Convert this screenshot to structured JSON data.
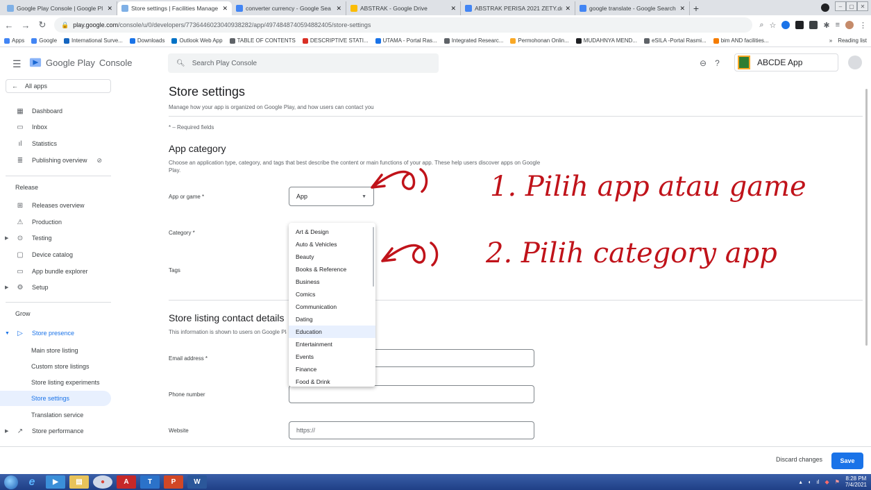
{
  "browser": {
    "tabs": [
      {
        "label": "Google Play Console | Google Pl",
        "active": false,
        "color": "#7fb0e6"
      },
      {
        "label": "Store settings | Facilities Manage",
        "active": true,
        "color": "#7fb0e6"
      },
      {
        "label": "converter currency - Google Sea",
        "active": false,
        "color": "#4285f4"
      },
      {
        "label": "ABSTRAK - Google Drive",
        "active": false,
        "color": "#fbbc04"
      },
      {
        "label": "ABSTRAK PERISA 2021 ZETY.doc",
        "active": false,
        "color": "#4285f4"
      },
      {
        "label": "google translate - Google Search",
        "active": false,
        "color": "#4285f4"
      }
    ],
    "url_host": "play.google.com",
    "url_path": "/console/u/0/developers/7736446023040938282/app/4974848740594882405/store-settings",
    "bookmarks": [
      {
        "label": "Apps",
        "color": "#4285f4"
      },
      {
        "label": "Google",
        "color": "#4285f4"
      },
      {
        "label": "International Surve...",
        "color": "#1565c0"
      },
      {
        "label": "Downloads",
        "color": "#1a73e8"
      },
      {
        "label": "Outlook Web App",
        "color": "#0072c6"
      },
      {
        "label": "TABLE OF CONTENTS",
        "color": "#5f6368"
      },
      {
        "label": "DESCRIPTIVE STATI...",
        "color": "#d93025"
      },
      {
        "label": "UTAMA - Portal Ras...",
        "color": "#1a73e8"
      },
      {
        "label": "Integrated Researc...",
        "color": "#5f6368"
      },
      {
        "label": "Permohonan Onlin...",
        "color": "#f9a825"
      },
      {
        "label": "MUDAHNYA MEND...",
        "color": "#202124"
      },
      {
        "label": "eSILA -Portal Rasmi...",
        "color": "#5f6368"
      },
      {
        "label": "bim AND facilities...",
        "color": "#f57c00"
      }
    ],
    "reading_list": "Reading list"
  },
  "header": {
    "brand": "Google Play",
    "brand_suffix": "Console",
    "search_placeholder": "Search Play Console",
    "app_name": "ABCDE App"
  },
  "sidebar": {
    "all_apps": "All apps",
    "items_top": [
      {
        "label": "Dashboard",
        "icon": "dashboard-icon"
      },
      {
        "label": "Inbox",
        "icon": "inbox-icon"
      },
      {
        "label": "Statistics",
        "icon": "statistics-icon"
      },
      {
        "label": "Publishing overview",
        "icon": "publishing-icon"
      }
    ],
    "release_label": "Release",
    "release_items": [
      {
        "label": "Releases overview"
      },
      {
        "label": "Production"
      },
      {
        "label": "Testing"
      },
      {
        "label": "Device catalog"
      },
      {
        "label": "App bundle explorer"
      },
      {
        "label": "Setup"
      }
    ],
    "grow_label": "Grow",
    "store_presence": "Store presence",
    "store_sub": [
      {
        "label": "Main store listing"
      },
      {
        "label": "Custom store listings"
      },
      {
        "label": "Store listing experiments"
      },
      {
        "label": "Store settings"
      },
      {
        "label": "Translation service"
      }
    ],
    "store_performance": "Store performance"
  },
  "main": {
    "title": "Store settings",
    "subtitle": "Manage how your app is organized on Google Play, and how users can contact you",
    "required_note": "* – Required fields",
    "app_category": {
      "title": "App category",
      "description": "Choose an application type, category, and tags that best describe the content or main functions of your app. These help users discover apps on Google Play.",
      "app_or_game_label": "App or game *",
      "app_or_game_value": "App",
      "category_label": "Category *",
      "tags_label": "Tags"
    },
    "category_options": [
      "Art & Design",
      "Auto & Vehicles",
      "Beauty",
      "Books & Reference",
      "Business",
      "Comics",
      "Communication",
      "Dating",
      "Education",
      "Entertainment",
      "Events",
      "Finance",
      "Food & Drink"
    ],
    "contact": {
      "title": "Store listing contact details",
      "description": "This information is shown to users on Google Play",
      "email_label": "Email address *",
      "phone_label": "Phone number",
      "website_label": "Website",
      "website_placeholder": "https://"
    }
  },
  "footer": {
    "discard": "Discard changes",
    "save": "Save"
  },
  "annotations": {
    "step1": "1. Pilih app atau game",
    "step2": "2. Pilih category app",
    "color": "#c0131a"
  },
  "taskbar": {
    "time": "8:28 PM",
    "date": "7/4/2021"
  }
}
